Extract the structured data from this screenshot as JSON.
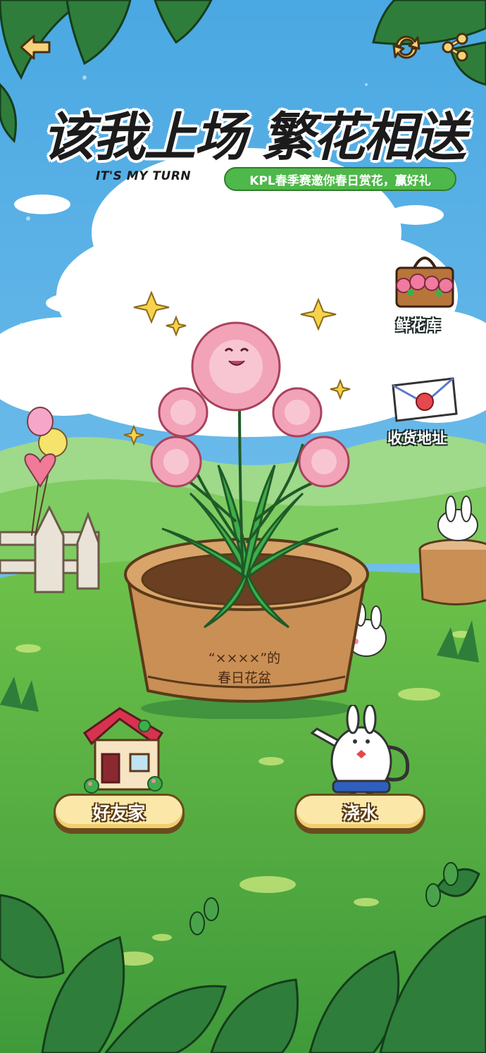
{
  "header": {
    "back_icon": "back-arrow-icon",
    "refresh_icon": "refresh-icon",
    "share_icon": "share-icon"
  },
  "title": {
    "main": "该我上场 繁花相送",
    "english": "IT'S MY TURN",
    "subtitle": "KPL春季赛邀你春日赏花，赢好礼"
  },
  "side_menu": {
    "flower_library": "鲜花库",
    "shipping_address": "收货地址"
  },
  "pot": {
    "owner_line": "“××××”的",
    "name_line": "春日花盆"
  },
  "actions": {
    "friends_home": "好友家",
    "water": "浇水"
  },
  "colors": {
    "sky": "#5fb4e6",
    "grass": "#4fb84a",
    "pot": "#c98f55",
    "flower": "#f2a3b8",
    "button": "#fbe8a8"
  }
}
